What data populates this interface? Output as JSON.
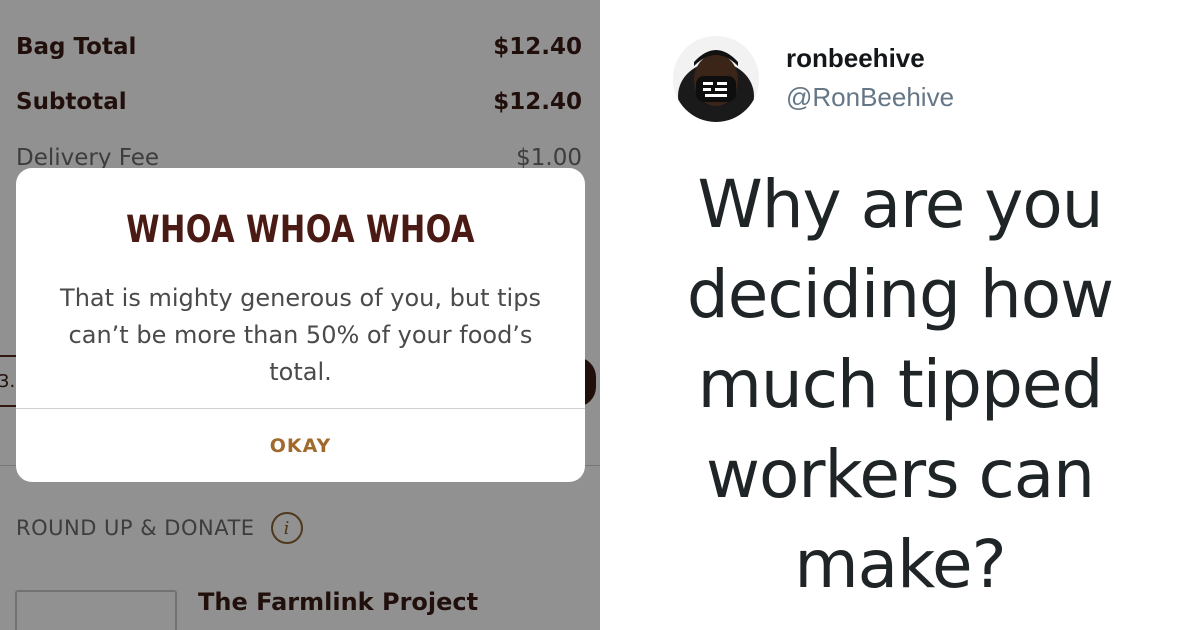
{
  "checkout": {
    "bag_total_label": "Bag Total",
    "bag_total_value": "$12.40",
    "subtotal_label": "Subtotal",
    "subtotal_value": "$12.40",
    "delivery_fee_label": "Delivery Fee",
    "delivery_fee_value": "$1.00",
    "tip_stub": "3.",
    "donate_label": "ROUND UP & DONATE",
    "info_glyph": "i",
    "charity_name": "The Farmlink Project"
  },
  "alert": {
    "title": "WHOA WHOA WHOA",
    "message": "That is mighty generous of you, but tips can’t be more than 50% of your food’s total.",
    "button_label": "OKAY"
  },
  "tweet": {
    "display_name": "ronbeehive",
    "handle": "@RonBeehive",
    "text": "Why are you deciding how much tipped workers can make?"
  },
  "colors": {
    "brand_dark": "#3a1b16",
    "accent_gold": "#a06a2c",
    "overlay": "rgba(0,0,0,0.43)"
  },
  "icons": [
    "info-icon",
    "avatar"
  ]
}
